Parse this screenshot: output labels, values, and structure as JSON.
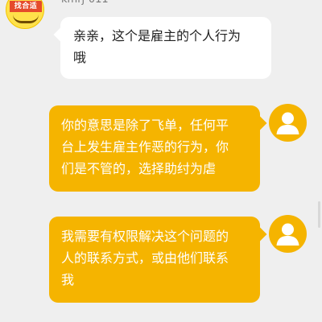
{
  "colors": {
    "background": "#efefef",
    "user_bubble": "#f5b400",
    "agent_bubble": "#ffffff",
    "avatar_yellow": "#ffe14a",
    "avatar_tag_red": "#e54b2b"
  },
  "agent": {
    "name": "kmrj-011",
    "avatar_text": "找合适",
    "avatar_icon": "smile-face-icon"
  },
  "messages": [
    {
      "sender": "agent",
      "text": "亲亲，这个是雇主的个人行为\n哦"
    },
    {
      "sender": "user",
      "text": "你的意思是除了飞单，任何平\n台上发生雇主作恶的行为，你\n们是不管的，选择助纣为虐",
      "avatar_icon": "user-silhouette-icon"
    },
    {
      "sender": "user",
      "text": "我需要有权限解决这个问题的\n人的联系方式，或由他们联系\n我",
      "avatar_icon": "user-silhouette-icon"
    }
  ]
}
